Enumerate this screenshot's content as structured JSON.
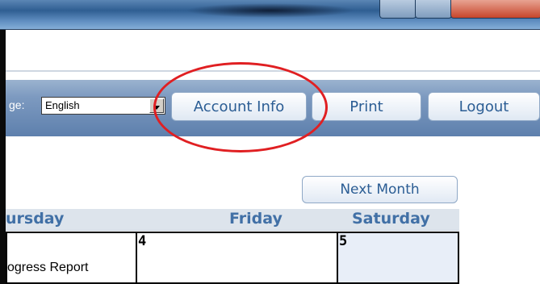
{
  "toolbar": {
    "language_label": "ge:",
    "language_value": "English",
    "account_info_label": "Account Info",
    "print_label": "Print",
    "logout_label": "Logout"
  },
  "calendar": {
    "next_month_label": "Next Month",
    "days": [
      "ursday",
      "Friday",
      "Saturday"
    ],
    "cells": [
      {
        "day": "",
        "event": "ogress Report"
      },
      {
        "day": "4",
        "event": ""
      },
      {
        "day": "5",
        "event": ""
      }
    ]
  },
  "colors": {
    "toolbar_bg": "#6f8fb8",
    "button_text": "#2b5d94",
    "day_header_text": "#4170a6",
    "highlight_cell": "#e8eef8",
    "annotation_circle": "#e01f22"
  }
}
